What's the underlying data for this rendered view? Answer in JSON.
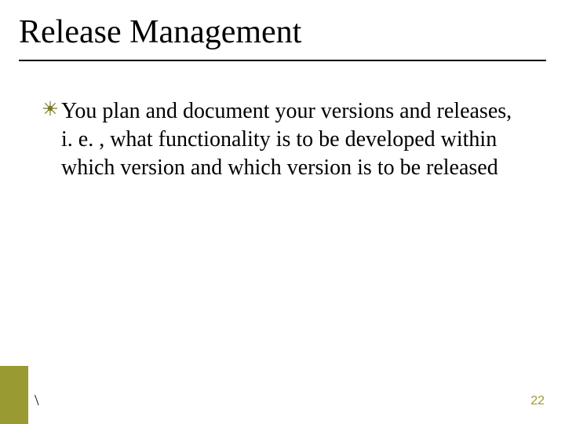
{
  "title": "Release Management",
  "body": {
    "items": [
      {
        "text": "You plan and document your versions and releases, i. e. , what functionality is to be developed within which version and which version is to be released"
      }
    ]
  },
  "footer": {
    "mark": "\\",
    "page": "22"
  },
  "theme": {
    "accent": "#9a9a33"
  }
}
